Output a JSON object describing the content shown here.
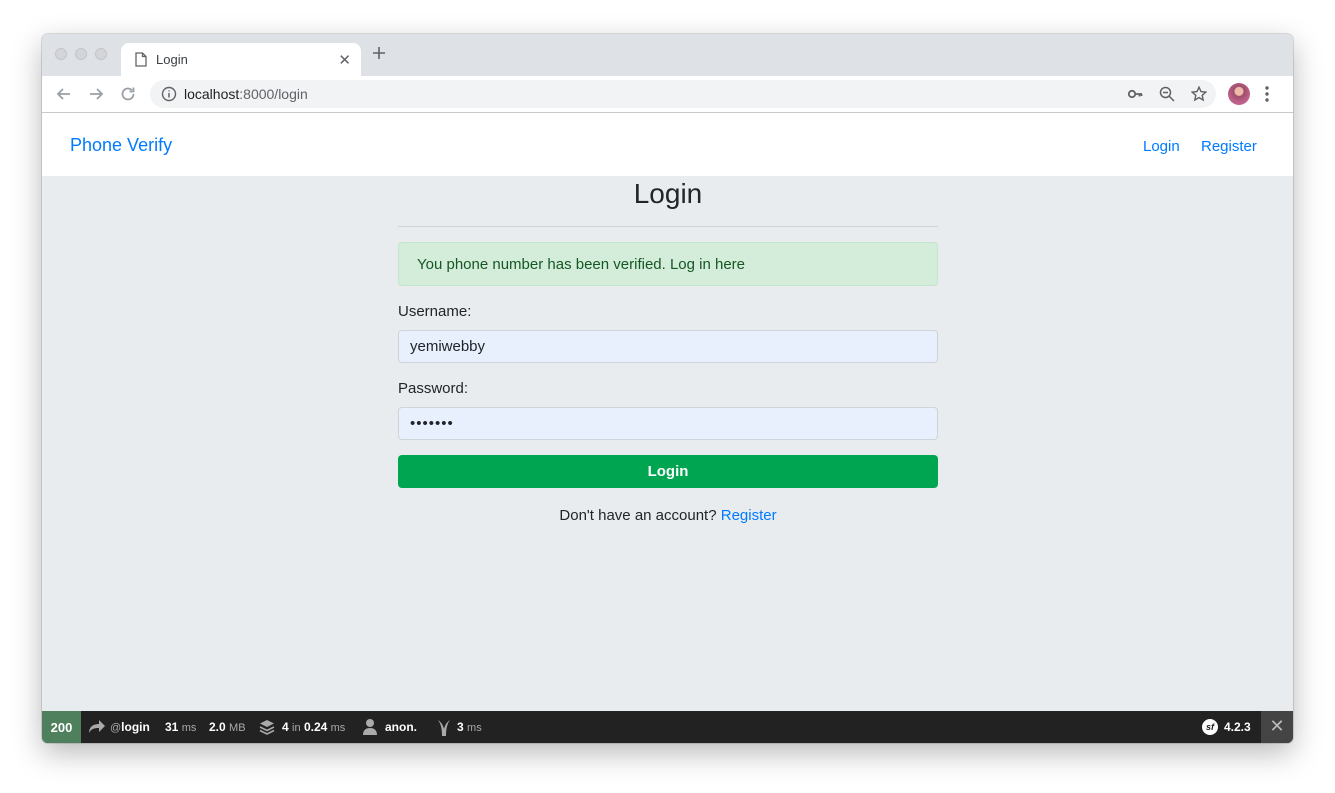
{
  "browser": {
    "tab_title": "Login",
    "new_tab_icon": "plus-icon",
    "url_host": "localhost",
    "url_rest": ":8000/login",
    "icons": [
      "back-arrow-icon",
      "forward-arrow-icon",
      "reload-icon",
      "info-icon",
      "key-icon",
      "zoom-out-icon",
      "star-icon",
      "avatar",
      "more-vert-icon"
    ]
  },
  "navbar": {
    "brand": "Phone Verify",
    "links": [
      "Login",
      "Register"
    ]
  },
  "main": {
    "heading": "Login",
    "alert": "You phone number has been verified. Log in here",
    "username_label": "Username:",
    "username_value": "yemiwebby",
    "password_label": "Password:",
    "password_value": "•••••••",
    "submit_label": "Login",
    "footer_prefix": "Don't have an account?",
    "footer_link": "Register"
  },
  "debug_toolbar": {
    "status": "200",
    "route_prefix": "@",
    "route": "login",
    "time_value": "31",
    "time_unit": "ms",
    "memory_value": "2.0",
    "memory_unit": "MB",
    "db_count": "4",
    "db_in": "in",
    "db_time": "0.24",
    "db_unit": "ms",
    "user": "anon.",
    "twig_value": "3",
    "twig_unit": "ms",
    "version": "4.2.3",
    "logo_text": "sf",
    "close_glyph": "✕",
    "colors": {
      "status_bg": "#4f805d",
      "bar_bg": "#222222"
    }
  },
  "colors": {
    "link": "#007bff",
    "button": "#00a551",
    "alert_bg": "#d4edda",
    "alert_text": "#155724",
    "page_bg": "#e9ecef"
  }
}
